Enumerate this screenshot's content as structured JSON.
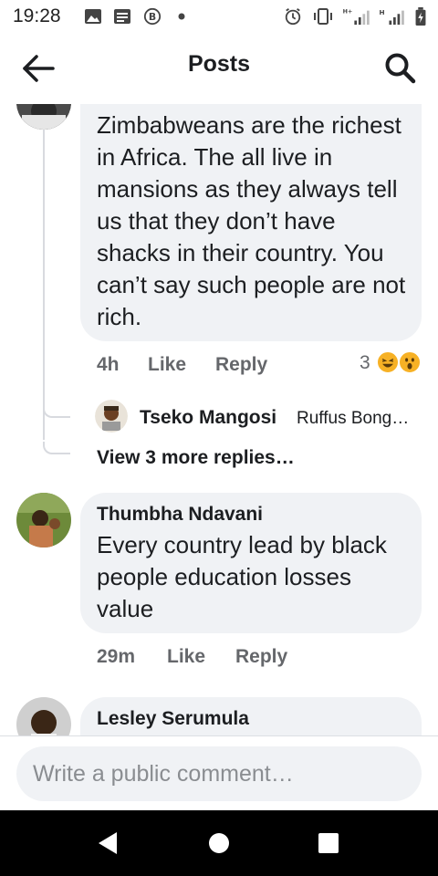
{
  "status_bar": {
    "time": "19:28",
    "icons": [
      "gallery-icon",
      "message-icon",
      "b-circle-icon",
      "dot-icon",
      "alarm-icon",
      "vibrate-icon",
      "signal-h-plus-icon",
      "signal-h-icon",
      "battery-icon"
    ]
  },
  "header": {
    "title": "Posts",
    "back_icon": "arrow-left-icon",
    "search_icon": "search-icon"
  },
  "comments": [
    {
      "text": "Zimbabweans are the richest in Africa. The all live in mansions as they always tell us that they don’t have shacks in their country. You can’t say such people are not rich.",
      "time": "4h",
      "like_label": "Like",
      "reply_label": "Reply",
      "reaction_count": "3",
      "reactions": [
        "laughing-emoji",
        "wow-emoji"
      ]
    },
    {
      "author": "Thumbha Ndavani",
      "text": "Every country lead by black people education losses value",
      "time": "29m",
      "like_label": "Like",
      "reply_label": "Reply"
    },
    {
      "author": "Lesley Serumula"
    }
  ],
  "reply_preview": {
    "author": "Tseko Mangosi",
    "snippet": "Ruffus Bong…"
  },
  "view_more_label": "View 3 more replies…",
  "composer": {
    "placeholder": "Write a public comment…"
  },
  "nav_bar": {
    "icons": [
      "back-triangle-icon",
      "home-circle-icon",
      "recents-square-icon"
    ]
  },
  "colors": {
    "bubble": "#f0f2f5",
    "meta_text": "#65676b",
    "primary_text": "#1c1e21",
    "nav_bar": "#000000"
  }
}
